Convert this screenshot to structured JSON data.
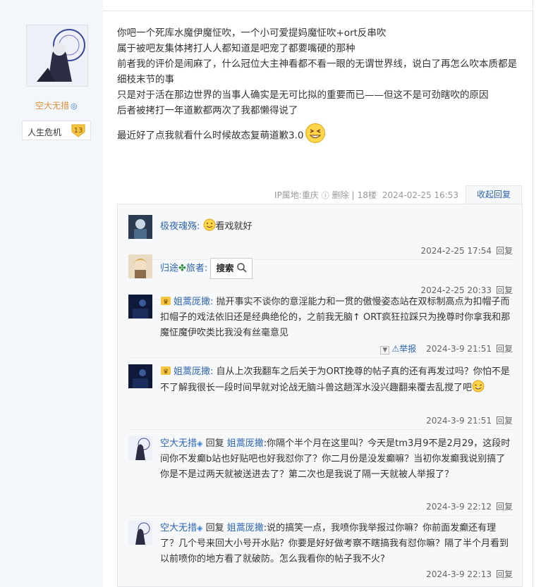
{
  "author": {
    "name": "空大无措",
    "level_name": "人生危机",
    "level_num": "13"
  },
  "post": {
    "lines": [
      "你吧一个死库水魔伊魔怔吹，一个小可爱提妈魔怔吹+ort反串吹",
      "属于被吧友集体拷打人人都知道是吧宠了都要嘴硬的那种",
      "前者我的评价是闹麻了，什么冠位大主神看都不看一眼的无谓世界线，说白了再怎么吹本质都是细枝末节的事",
      "只是对于活在那边世界的当事人确实是无可比拟的重要而已——但这不是可劲瞎吹的原因",
      "后者被拷打一年道歉都两次了我都懒得说了",
      "最近好了点我就看什么时候故态复萌道歉3.0"
    ],
    "ip": "IP属地:重庆",
    "delete": "删除",
    "floor": "18楼",
    "time": "2024-02-25 16:53",
    "collapse": "收起回复"
  },
  "replies": [
    {
      "user": "极夜魂殇:",
      "text": "看戏就好",
      "time": "2024-2-25 17:54",
      "reply": "回复"
    },
    {
      "user": "归途",
      "user2": "旅者:",
      "search": "搜索",
      "time": "2024-2-25 20:33",
      "reply": "回复"
    },
    {
      "user": "姐蒿厐撖:",
      "text": "抛开事实不谈你的意淫能力和一贯的傲慢姿态站在双标制高点为扣帽子而扣帽子的戏法依旧还是经典绝伦的，之前我无脑↑ ORT疯狂拉踩只为挽尊时你拿我和那魔怔魔伊吹类比我没有丝毫意见",
      "report": "举报",
      "time": "2024-3-9 21:51",
      "reply": "回复"
    },
    {
      "user": "姐蒿厐撖:",
      "text": "自从上次我翻车之后关于为ORT挽尊的帖子真的还有再发过吗？你怕不是不了解我很长一段时间早就对论战无脑斗兽这趟浑水没兴趣翻来覆去乱搅了吧",
      "time": "2024-3-9 21:51",
      "reply": "回复"
    },
    {
      "user": "空大无措",
      "reply_word": "回复",
      "target": "姐蒿厐撖",
      "text": ":你隔个半个月在这里叫？今天是tm3月9不是2月29，这段时间你不发癫b站也好贴吧也好我怼你了？你二月份是没发癫嘛？当初你发癫我说别搞了你是不是过两天就被送进去了？第二次也是我说了隔一天就被人举报了？",
      "time": "2024-3-9 22:12",
      "reply": "回复"
    },
    {
      "user": "空大无措",
      "reply_word": "回复",
      "target": "姐蒿厐撖",
      "text": ":说的搞笑一点，我喷你我举报过你嘛？你前面发癫还有理了？几个号来回大小号开水贴？你要是好好做考察不瞎搞我有怼你嘛？隔了半个月看到以前喷你的地方看了就破防。怎么我看你的帖子我不火?",
      "time": "2024-3-9 22:13",
      "reply": "回复"
    }
  ],
  "colors": {
    "link": "#2d64b3",
    "author": "#e0913a",
    "sidebar": "#f3f7fc",
    "lzl_bg": "#f7f8fa"
  },
  "icons": [
    "face-smile-icon",
    "grin-icon",
    "search-icon",
    "clover-icon",
    "member-icon",
    "dropdown-icon",
    "warning-icon",
    "swirl-icon",
    "diamond-icon"
  ]
}
